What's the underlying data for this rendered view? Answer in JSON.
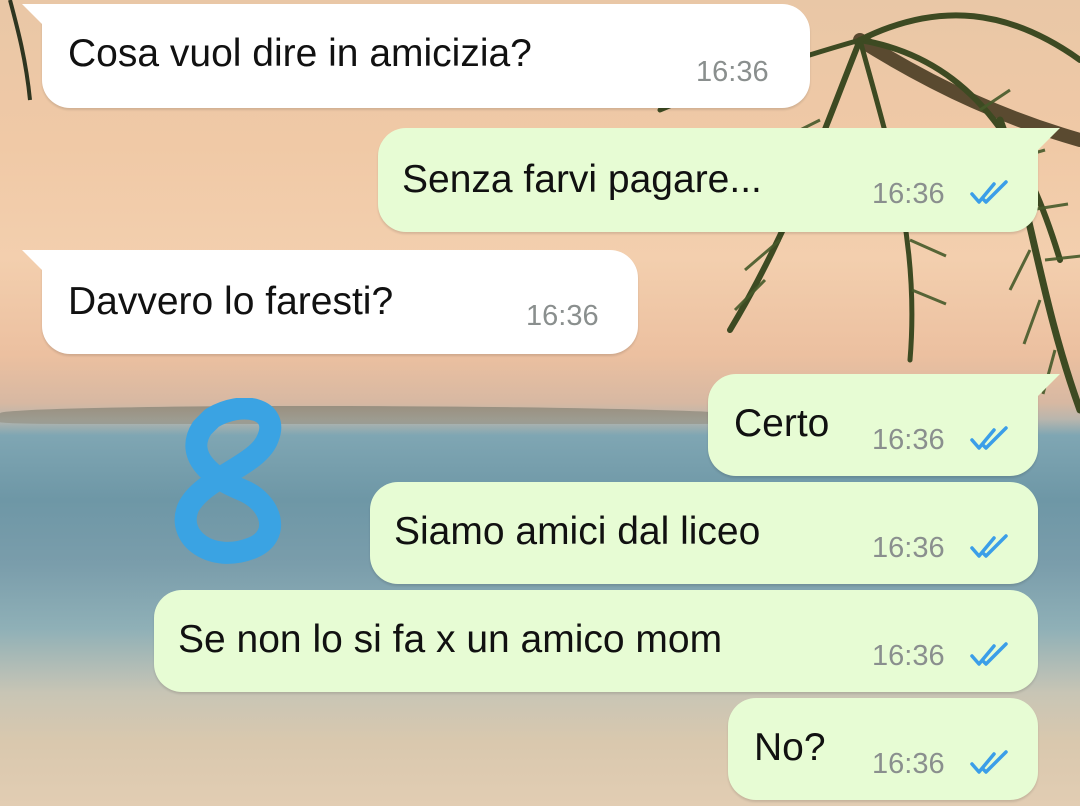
{
  "chat": {
    "messages": [
      {
        "direction": "incoming",
        "text": "Cosa vuol dire in amicizia?",
        "time": "16:36"
      },
      {
        "direction": "outgoing",
        "text": "Senza farvi pagare...",
        "time": "16:36",
        "status": "read"
      },
      {
        "direction": "incoming",
        "text": "Davvero lo faresti?",
        "time": "16:36"
      },
      {
        "direction": "outgoing",
        "text": "Certo",
        "time": "16:36",
        "status": "read"
      },
      {
        "direction": "outgoing",
        "text": "Siamo amici dal liceo",
        "time": "16:36",
        "status": "read"
      },
      {
        "direction": "outgoing",
        "text": "Se non lo si fa x un amico mom",
        "time": "16:36",
        "status": "read"
      },
      {
        "direction": "outgoing",
        "text": "No?",
        "time": "16:36",
        "status": "read"
      }
    ]
  },
  "colors": {
    "incoming_bubble": "#ffffff",
    "outgoing_bubble": "#e7fcd4",
    "read_ticks": "#3b9ee8",
    "annotation": "#3aa3e3"
  },
  "icons": {
    "read_status": "double-check-icon"
  },
  "annotation": {
    "handwritten": "8"
  }
}
